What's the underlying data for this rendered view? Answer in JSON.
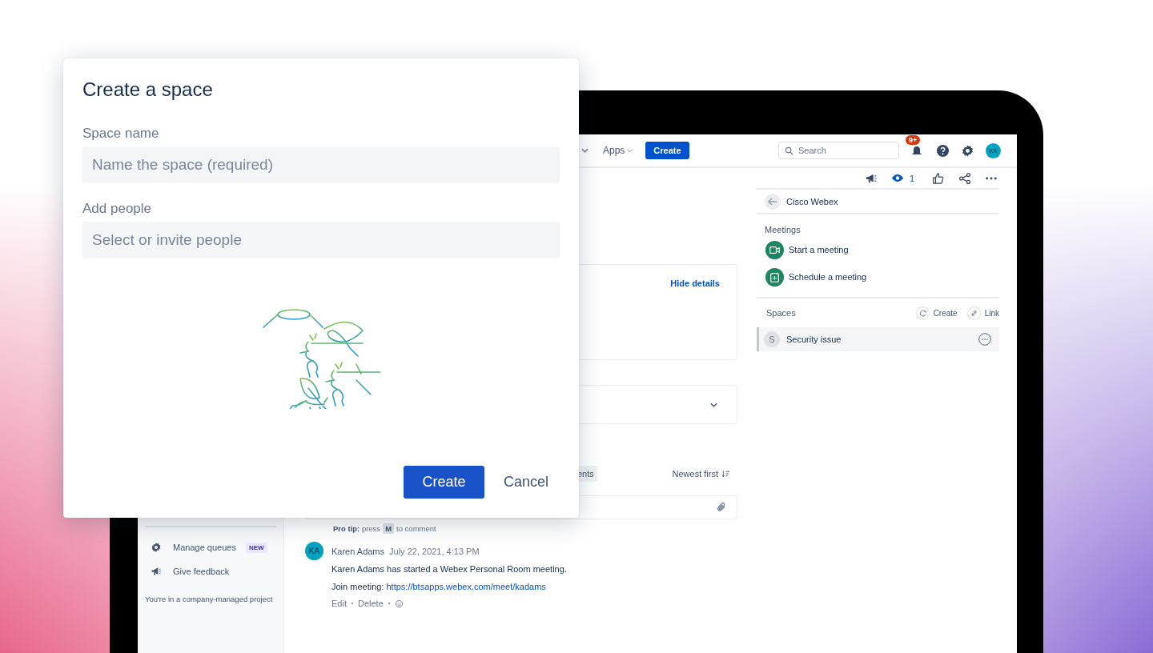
{
  "top_nav": {
    "items": [
      {
        "label": "Apps"
      }
    ],
    "create": "Create",
    "search": {
      "placeholder": "Search"
    },
    "notification_badge": "9+",
    "avatar": "KA"
  },
  "issue_toolbar": {
    "watchers": "1"
  },
  "details_card": {
    "link": "Hide details"
  },
  "activity": {
    "tab_label": "ents",
    "sort": "Newest first",
    "pro_tip": {
      "text_before": "**Pro tip:** press",
      "key": "M",
      "text_after": "to comment"
    },
    "comments": [
      {
        "initials": "KA",
        "author": "Karen Adams",
        "date": "July 22, 2021, 4:13 PM",
        "body": "Karen Adams has started a Webex Personal Room meeting.",
        "join_label": "Join meeting:",
        "link": "https://btsapps.webex.com/meet/kadams",
        "actions": [
          "Edit",
          "Delete"
        ]
      }
    ]
  },
  "sidebar": {
    "items": [
      {
        "label": "Manage queues",
        "badge": "NEW",
        "kind": "gear"
      },
      {
        "label": "Give feedback",
        "kind": "megaphone"
      }
    ],
    "footer": "You're in a company-managed project"
  },
  "webex_panel": {
    "title": "Cisco Webex",
    "meetings_heading": "Meetings",
    "meeting_actions": [
      {
        "label": "Start a meeting",
        "kind": "video"
      },
      {
        "label": "Schedule a meeting",
        "kind": "calendar"
      }
    ],
    "spaces_heading": "Spaces",
    "space_actions": [
      {
        "label": "Create",
        "kind": "create"
      },
      {
        "label": "Link",
        "kind": "link"
      }
    ],
    "spaces": [
      {
        "initial": "S",
        "name": "Security issue"
      }
    ]
  },
  "dialog": {
    "title": "Create a space",
    "fields": [
      {
        "label": "Space name",
        "placeholder": "Name the space (required)"
      },
      {
        "label": "Add people",
        "placeholder": "Select or invite people"
      }
    ],
    "buttons": [
      {
        "label": "Create",
        "kind": "primary"
      },
      {
        "label": "Cancel",
        "kind": "subtle"
      }
    ]
  }
}
